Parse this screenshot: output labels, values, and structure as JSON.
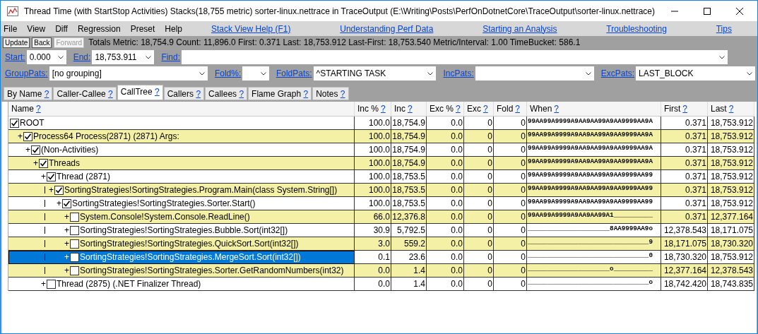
{
  "window": {
    "title": "Thread Time (with StartStop Activities) Stacks(18,755 metric) sorter-linux.nettrace in TraceOutput (E:\\Writing\\Posts\\PerfOnDotnetCore\\TraceOutput\\sorter-linux.nettrace)"
  },
  "menu": [
    "File",
    "View",
    "Diff",
    "Regression",
    "Preset",
    "Help"
  ],
  "help_links": [
    "Stack View Help (F1)",
    "Understanding Perf Data",
    "Starting an Analysis",
    "Troubleshooting",
    "Tips"
  ],
  "toolbar": {
    "buttons": [
      {
        "label": "Update",
        "disabled": false
      },
      {
        "label": "Back",
        "disabled": false
      },
      {
        "label": "Forward",
        "disabled": true
      }
    ],
    "stats": "Totals Metric: 18,754.9  Count: 11,896.0  First: 0.371 Last: 18,753.912  Last-First: 18,753.540  Metric/Interval: 1.00  TimeBucket: 586.1"
  },
  "filter_rows": [
    [
      {
        "label": "Start:",
        "value": "0.000"
      },
      {
        "label": "End:",
        "value": "18,753.911"
      },
      {
        "label": "Find:"
      }
    ],
    [
      {
        "label": "GroupPats:",
        "value": "[no grouping]"
      },
      {
        "label": "Fold%:"
      },
      {
        "label": "FoldPats:",
        "value": "^STARTING TASK"
      },
      {
        "label": "IncPats:"
      },
      {
        "label": "ExcPats:",
        "value": "LAST_BLOCK"
      }
    ]
  ],
  "tabs": [
    {
      "label": "By Name",
      "help": "?",
      "selected": false
    },
    {
      "label": "Caller-Callee",
      "help": "?",
      "selected": false
    },
    {
      "label": "CallTree",
      "help": "?",
      "selected": true
    },
    {
      "label": "Callers",
      "help": "?",
      "selected": false
    },
    {
      "label": "Callees",
      "help": "?",
      "selected": false
    },
    {
      "label": "Flame Graph",
      "help": "?",
      "selected": false
    },
    {
      "label": "Notes",
      "help": "?",
      "selected": false
    }
  ],
  "columns": [
    {
      "label": "Name",
      "help": "?"
    },
    {
      "label": "Inc %",
      "help": "?"
    },
    {
      "label": "Inc",
      "help": "?"
    },
    {
      "label": "Exc %",
      "help": "?"
    },
    {
      "label": "Exc",
      "help": "?"
    },
    {
      "label": "Fold",
      "help": "?"
    },
    {
      "label": "When",
      "help": "?"
    },
    {
      "label": "First",
      "help": "?"
    },
    {
      "label": "Last",
      "help": "?"
    }
  ],
  "tree": [
    {
      "name": "ROOT",
      "checked": true,
      "selected": false,
      "inc_pct": "100.0",
      "inc": "18,754.9",
      "exc_pct": "0.0",
      "exc": "0",
      "fold": "0",
      "when": "99AA99A9999A9AA9AA99A9AA9999AA9A",
      "first": "0.371",
      "last": "18,753.912",
      "children": [
        {
          "name": "Process64 Process(2871) (2871) Args: ",
          "toggle": "+",
          "checked": true,
          "selected": false,
          "inc_pct": "100.0",
          "inc": "18,754.9",
          "exc_pct": "0.0",
          "exc": "0",
          "fold": "0",
          "when": "99AA99A9999A9AA9AA99A9AA9999AA9A",
          "first": "0.371",
          "last": "18,753.912",
          "children": [
            {
              "name": "(Non-Activities)",
              "toggle": "+",
              "checked": true,
              "selected": false,
              "inc_pct": "100.0",
              "inc": "18,754.9",
              "exc_pct": "0.0",
              "exc": "0",
              "fold": "0",
              "when": "99AA99A9999A9AA9AA99A9AA9999AA9A",
              "first": "0.371",
              "last": "18,753.912",
              "children": [
                {
                  "name": "Threads",
                  "toggle": "+",
                  "checked": true,
                  "selected": false,
                  "inc_pct": "100.0",
                  "inc": "18,754.9",
                  "exc_pct": "0.0",
                  "exc": "0",
                  "fold": "0",
                  "when": "99AA99A9999A9AA9AA99A9AA9999AA9A",
                  "first": "0.371",
                  "last": "18,753.912",
                  "children": [
                    {
                      "name": "Thread (2871)",
                      "toggle": "+",
                      "checked": true,
                      "selected": false,
                      "inc_pct": "100.0",
                      "inc": "18,753.5",
                      "exc_pct": "0.0",
                      "exc": "0",
                      "fold": "0",
                      "when": "99AA99A9999A9AA9AA99A9AA9999AA99",
                      "first": "0.371",
                      "last": "18,753.912",
                      "children": [
                        {
                          "name": "SortingStrategies!SortingStrategies.Program.Main(class System.String[])",
                          "toggle": "+",
                          "checked": true,
                          "selected": false,
                          "inc_pct": "100.0",
                          "inc": "18,753.5",
                          "exc_pct": "0.0",
                          "exc": "0",
                          "fold": "0",
                          "when": "99AA99A9999A9AA9AA99A9AA9999AA99",
                          "first": "0.371",
                          "last": "18,753.912",
                          "children": [
                            {
                              "name": "SortingStrategies!SortingStrategies.Sorter.Start()",
                              "toggle": "+",
                              "checked": true,
                              "selected": false,
                              "inc_pct": "100.0",
                              "inc": "18,753.5",
                              "exc_pct": "0.0",
                              "exc": "0",
                              "fold": "0",
                              "when": "99AA99A9999A9AA9AA99A9AA9999AA99",
                              "first": "0.371",
                              "last": "18,753.912",
                              "children": [
                                {
                                  "name": "System.Console!System.Console.ReadLine()",
                                  "toggle": "+",
                                  "checked": false,
                                  "selected": false,
                                  "inc_pct": "66.0",
                                  "inc": "12,376.8",
                                  "exc_pct": "0.0",
                                  "exc": "0",
                                  "fold": "0",
                                  "when": "99AA99A9999A9AA9AA99A1__________",
                                  "first": "0.371",
                                  "last": "12,377.164"
                                },
                                {
                                  "name": "SortingStrategies!SortingStrategies.Bubble.Sort(int32[])",
                                  "toggle": "+",
                                  "checked": false,
                                  "selected": false,
                                  "inc_pct": "30.9",
                                  "inc": "5,792.5",
                                  "exc_pct": "0.0",
                                  "exc": "0",
                                  "fold": "0",
                                  "when": "_____________________8AA9999AA9o",
                                  "first": "12,378.543",
                                  "last": "18,171.075"
                                },
                                {
                                  "name": "SortingStrategies!SortingStrategies.QuickSort.Sort(int32[])",
                                  "toggle": "+",
                                  "checked": false,
                                  "selected": false,
                                  "inc_pct": "3.0",
                                  "inc": "559.2",
                                  "exc_pct": "0.0",
                                  "exc": "0",
                                  "fold": "0",
                                  "when": "_______________________________9",
                                  "first": "18,171.075",
                                  "last": "18,730.320"
                                },
                                {
                                  "name": "SortingStrategies!SortingStrategies.MergeSort.Sort(int32[])",
                                  "toggle": "+",
                                  "checked": false,
                                  "selected": true,
                                  "inc_pct": "0.1",
                                  "inc": "23.6",
                                  "exc_pct": "0.0",
                                  "exc": "0",
                                  "fold": "0",
                                  "when": "_______________________________0",
                                  "first": "18,730.320",
                                  "last": "18,753.912"
                                },
                                {
                                  "name": "SortingStrategies!SortingStrategies.Sorter.GetRandomNumbers(int32)",
                                  "toggle": "+",
                                  "checked": false,
                                  "selected": false,
                                  "inc_pct": "0.0",
                                  "inc": "1.4",
                                  "exc_pct": "0.0",
                                  "exc": "0",
                                  "fold": "0",
                                  "when": "_____________________o__________",
                                  "first": "12,377.164",
                                  "last": "12,378.543"
                                }
                              ]
                            }
                          ]
                        }
                      ]
                    },
                    {
                      "name": "Thread (2875) (.NET Finalizer Thread)",
                      "toggle": "+",
                      "checked": false,
                      "selected": false,
                      "inc_pct": "0.0",
                      "inc": "1.4",
                      "exc_pct": "0.0",
                      "exc": "0",
                      "fold": "0",
                      "when": "_______________________________o",
                      "first": "18,742.420",
                      "last": "18,743.835"
                    }
                  ]
                }
              ]
            }
          ]
        }
      ]
    }
  ]
}
